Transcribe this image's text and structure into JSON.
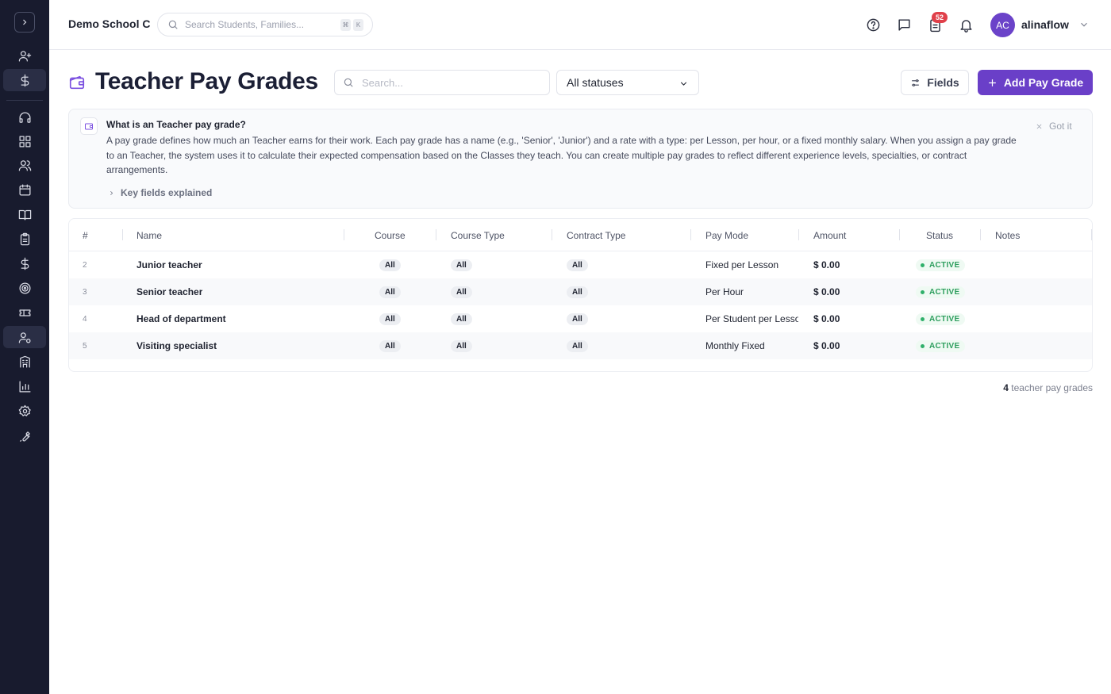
{
  "app": {
    "school_name": "Demo School C",
    "global_search_placeholder": "Search Students, Families...",
    "shortcut_key_1": "⌘",
    "shortcut_key_2": "K",
    "notification_count": "52",
    "user_initials": "AC",
    "username": "alinaflow"
  },
  "page": {
    "title": "Teacher Pay Grades",
    "search_placeholder": "Search...",
    "status_filter": "All statuses",
    "fields_label": "Fields",
    "add_label": "Add Pay Grade"
  },
  "info": {
    "title": "What is an Teacher pay grade?",
    "body": "A pay grade defines how much an Teacher earns for their work. Each pay grade has a name (e.g., 'Senior', 'Junior') and a rate with a type: per Lesson, per hour, or a fixed monthly salary. When you assign a pay grade to an Teacher, the system uses it to calculate their expected compensation based on the Classes they teach. You can create multiple pay grades to reflect different experience levels, specialties, or contract arrangements.",
    "dismiss_label": "Got it",
    "key_fields_label": "Key fields explained"
  },
  "table": {
    "columns": [
      "#",
      "Name",
      "Course",
      "Course Type",
      "Contract Type",
      "Pay Mode",
      "Amount",
      "Status",
      "Notes"
    ],
    "rows": [
      {
        "index": "2",
        "name": "Junior teacher",
        "course": "All",
        "course_type": "All",
        "contract_type": "All",
        "pay_mode": "Fixed per Lesson",
        "amount": "$ 0.00",
        "status": "ACTIVE",
        "notes": ""
      },
      {
        "index": "3",
        "name": "Senior teacher",
        "course": "All",
        "course_type": "All",
        "contract_type": "All",
        "pay_mode": "Per Hour",
        "amount": "$ 0.00",
        "status": "ACTIVE",
        "notes": ""
      },
      {
        "index": "4",
        "name": "Head of department",
        "course": "All",
        "course_type": "All",
        "contract_type": "All",
        "pay_mode": "Per Student per Lesson",
        "amount": "$ 0.00",
        "status": "ACTIVE",
        "notes": ""
      },
      {
        "index": "5",
        "name": "Visiting specialist",
        "course": "All",
        "course_type": "All",
        "contract_type": "All",
        "pay_mode": "Monthly Fixed",
        "amount": "$ 0.00",
        "status": "ACTIVE",
        "notes": ""
      }
    ]
  },
  "footer": {
    "count": "4",
    "count_label": "teacher pay grades"
  },
  "colors": {
    "sidebar_bg": "#181b2e",
    "accent": "#6a3fc8",
    "status_active": "#2e9e5e",
    "badge": "#e0404a"
  }
}
